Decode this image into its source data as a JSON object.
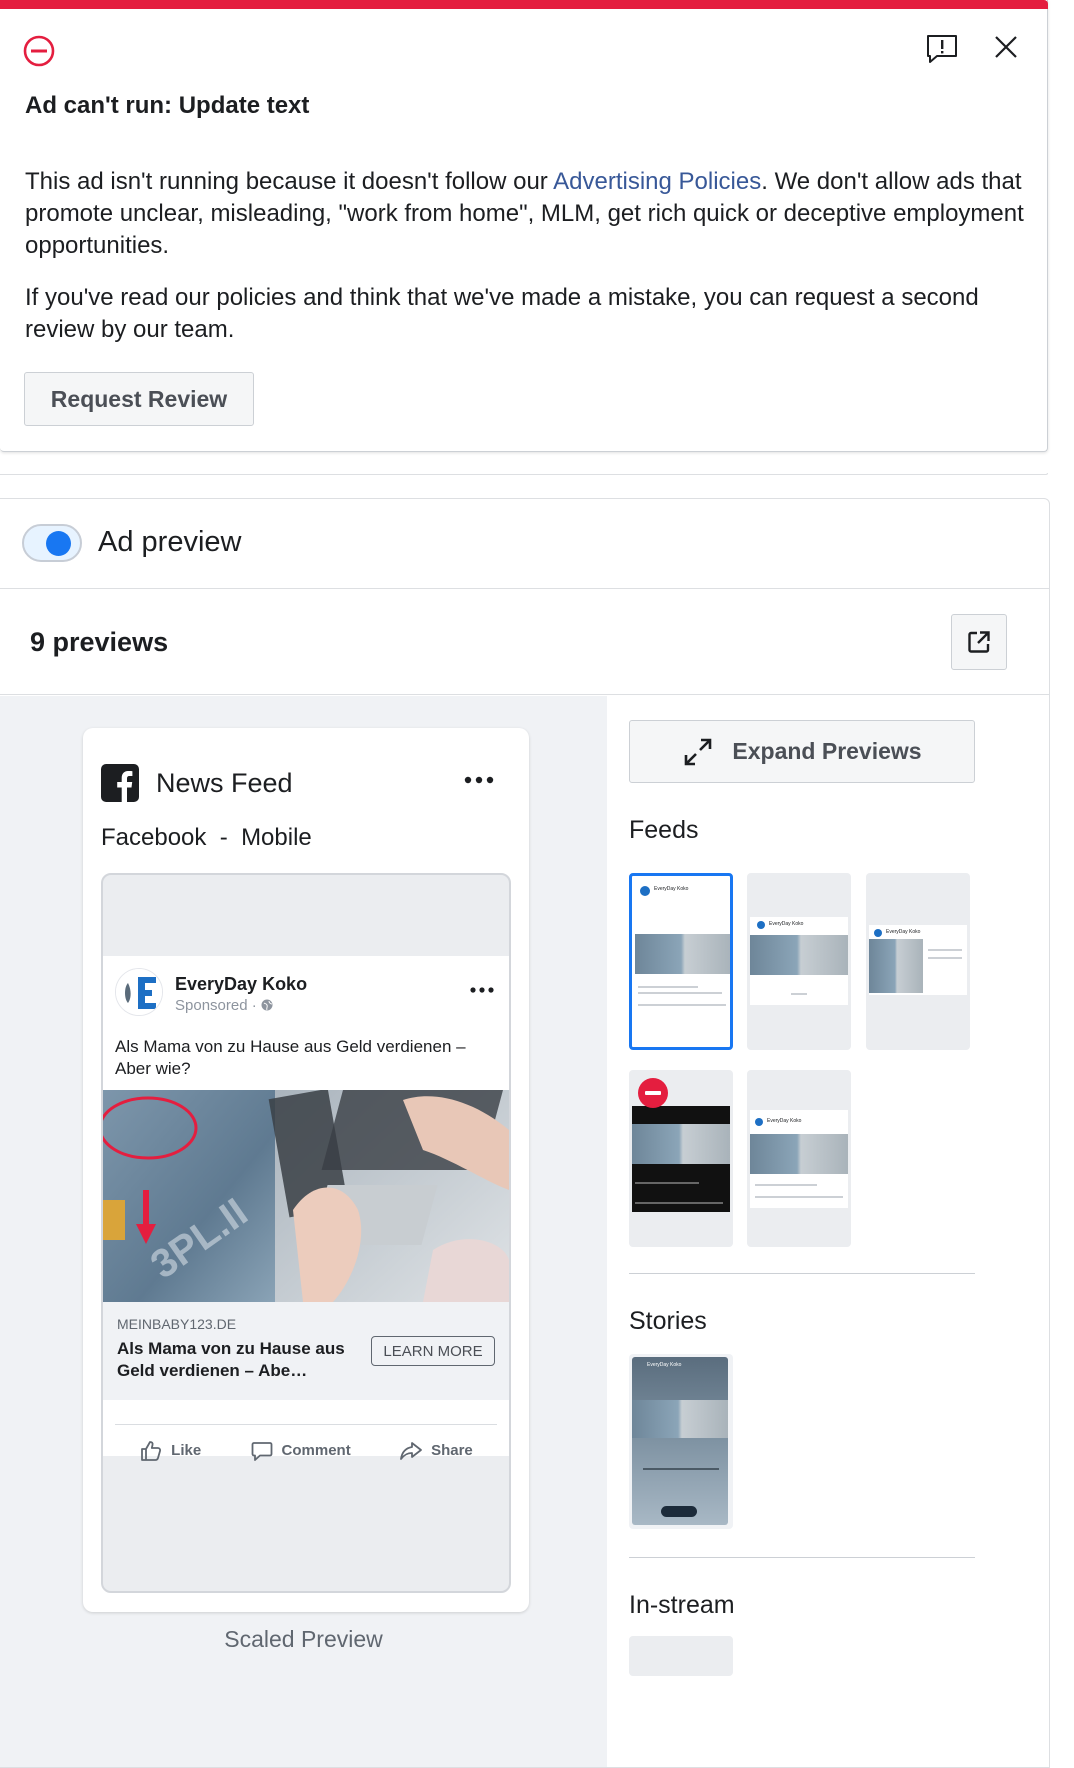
{
  "alert": {
    "title": "Ad can't run: Update text",
    "body_before_link": "This ad isn't running because it doesn't follow our ",
    "link_text": "Advertising Policies",
    "body_after_link": ". We don't allow ads that promote unclear, misleading, \"work from home\", MLM, get rich quick or deceptive employment opportunities.",
    "second_paragraph": "If you've read our policies and think that we've made a mistake, you can request a second review by our team.",
    "button_label": "Request Review",
    "icons": [
      "no-entry-icon",
      "feedback-icon",
      "close-icon"
    ]
  },
  "preview": {
    "toggle_label": "Ad preview",
    "toggle_on": true,
    "count_label": "9 previews",
    "placement_title": "News Feed",
    "placement_sub": "Facebook  -  Mobile",
    "scaled_label": "Scaled Preview",
    "expand_label": "Expand Previews"
  },
  "post": {
    "page_name": "EveryDay Koko",
    "sponsored": "Sponsored · ",
    "text": "Als Mama von zu Hause aus Geld verdienen – Aber wie?",
    "domain": "MEINBABY123.DE",
    "headline": "Als Mama von zu Hause aus Geld verdienen – Abe…",
    "cta": "LEARN MORE",
    "actions": {
      "like": "Like",
      "comment": "Comment",
      "share": "Share"
    }
  },
  "sections": {
    "feeds": "Feeds",
    "stories": "Stories",
    "instream": "In-stream"
  },
  "thumb_page_name": "EveryDay Koko",
  "colors": {
    "alert_red": "#e41e3f",
    "link_blue": "#385898",
    "accent_blue": "#1877f2",
    "panel_gray": "#f0f2f5"
  }
}
